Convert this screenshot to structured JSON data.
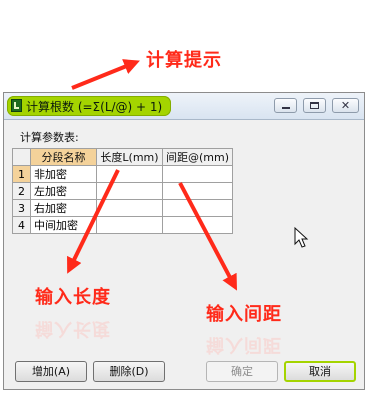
{
  "annotations": {
    "calc_hint": "计算提示",
    "input_length": "输入长度",
    "input_spacing": "输入间距",
    "color": "#ff2a1a"
  },
  "dialog": {
    "title": "计算根数 (=Σ(L/@) + 1)",
    "title_highlight_color": "#a4d400",
    "close_glyph": "✕",
    "params_label": "计算参数表:",
    "table": {
      "headers": [
        "分段名称",
        "长度L(mm)",
        "间距@(mm)"
      ],
      "rows": [
        {
          "num": "1",
          "name": "非加密",
          "length": "",
          "spacing": ""
        },
        {
          "num": "2",
          "name": "左加密",
          "length": "",
          "spacing": ""
        },
        {
          "num": "3",
          "name": "右加密",
          "length": "",
          "spacing": ""
        },
        {
          "num": "4",
          "name": "中间加密",
          "length": "",
          "spacing": ""
        }
      ]
    },
    "buttons": {
      "add": "增加(A)",
      "delete": "删除(D)",
      "ok": "确定",
      "cancel": "取消"
    }
  },
  "icons": [
    "app-icon",
    "minimize-icon",
    "maximize-icon",
    "close-icon",
    "mouse-cursor-icon"
  ]
}
